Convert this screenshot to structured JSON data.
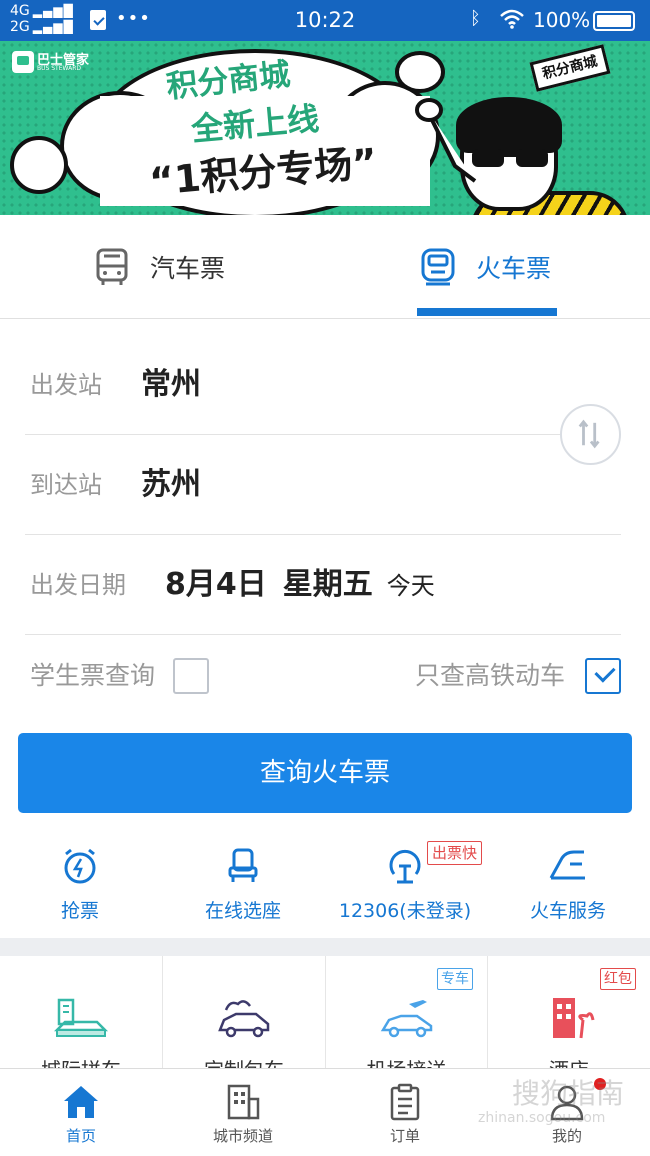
{
  "status_bar": {
    "net_top": "4G",
    "net_bottom": "2G",
    "time": "10:22",
    "battery": "100%"
  },
  "banner": {
    "logo_text": "巴士管家",
    "logo_sub": "BUS STEWARD",
    "line1": "积分商城",
    "line2": "全新上线",
    "line3": "“1积分专场”",
    "sign": "积分商城"
  },
  "tabs": {
    "bus": "汽车票",
    "train": "火车票"
  },
  "form": {
    "from_label": "出发站",
    "from_value": "常州",
    "to_label": "到达站",
    "to_value": "苏州",
    "date_label": "出发日期",
    "date_value": "8月4日",
    "weekday": "星期五",
    "today": "今天",
    "student_label": "学生票查询",
    "student_checked": false,
    "highspeed_label": "只查高铁动车",
    "highspeed_checked": true
  },
  "search_button": "查询火车票",
  "quick_actions": [
    {
      "label": "抢票",
      "icon": "alarm-clock-icon"
    },
    {
      "label": "在线选座",
      "icon": "seat-icon"
    },
    {
      "label": "12306(未登录)",
      "icon": "railway-icon",
      "tag": "出票快"
    },
    {
      "label": "火车服务",
      "icon": "train-service-icon"
    }
  ],
  "services": [
    {
      "label": "城际拼车",
      "icon": "city-carpool-icon"
    },
    {
      "label": "定制包车",
      "icon": "charter-car-icon"
    },
    {
      "label": "机场接送",
      "icon": "airport-transfer-icon",
      "tag": "专车"
    },
    {
      "label": "酒店",
      "icon": "hotel-icon",
      "tag": "红包"
    }
  ],
  "bottom_nav": [
    {
      "label": "首页",
      "icon": "home-icon",
      "active": true
    },
    {
      "label": "城市频道",
      "icon": "city-icon"
    },
    {
      "label": "订单",
      "icon": "order-icon"
    },
    {
      "label": "我的",
      "icon": "profile-icon"
    }
  ],
  "watermark": {
    "text": "搜狗指南",
    "sub": "zhinan.sogou.com"
  },
  "colors": {
    "primary": "#1677d2",
    "button": "#1a86e8",
    "status_bar": "#1565c0",
    "banner": "#2fbf8e",
    "tag_red": "#e34b4b",
    "tag_blue": "#4aa3e8"
  }
}
